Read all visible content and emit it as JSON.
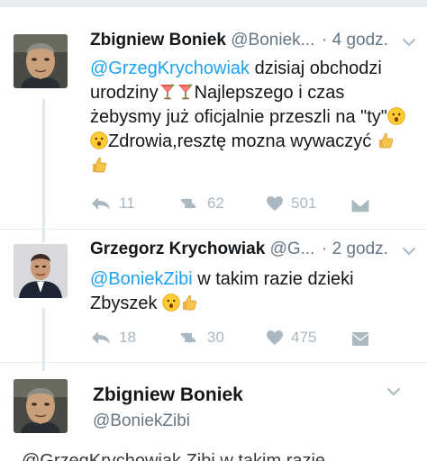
{
  "tweets": [
    {
      "name": "Zbigniew Boniek",
      "handle": "@Boniek...",
      "dot": "·",
      "time": "4 godz.",
      "mention": "@GrzegKrychowiak",
      "text_1": " dzisiaj obchodzi urodziny",
      "text_2": "Najlepszego i czas żebysmy już oficjalnie przeszli na \"ty\"",
      "text_3": "Zdrowia,resztę mozna wywaczyć",
      "replies": "11",
      "retweets": "62",
      "likes": "501"
    },
    {
      "name": "Grzegorz Krychowiak",
      "handle": "@G...",
      "dot": "·",
      "time": "2 godz.",
      "mention": "@BoniekZibi",
      "text_1": " w takim razie dzieki Zbyszek",
      "replies": "18",
      "retweets": "30",
      "likes": "475"
    }
  ],
  "focused": {
    "name": "Zbigniew Boniek",
    "handle": "@BoniekZibi",
    "cut_text": "@GrzegKrychowiak Zibi w takim razie"
  },
  "icons": [
    "reply-icon",
    "retweet-icon",
    "like-icon",
    "dm-icon",
    "chevron-down-icon",
    "cocktail-emoji",
    "hushed-emoji",
    "thumbs-up-emoji"
  ],
  "colors": {
    "link": "#1da1f2",
    "muted": "#657786",
    "action": "#aab8c2",
    "thread": "#e1e8ed"
  }
}
